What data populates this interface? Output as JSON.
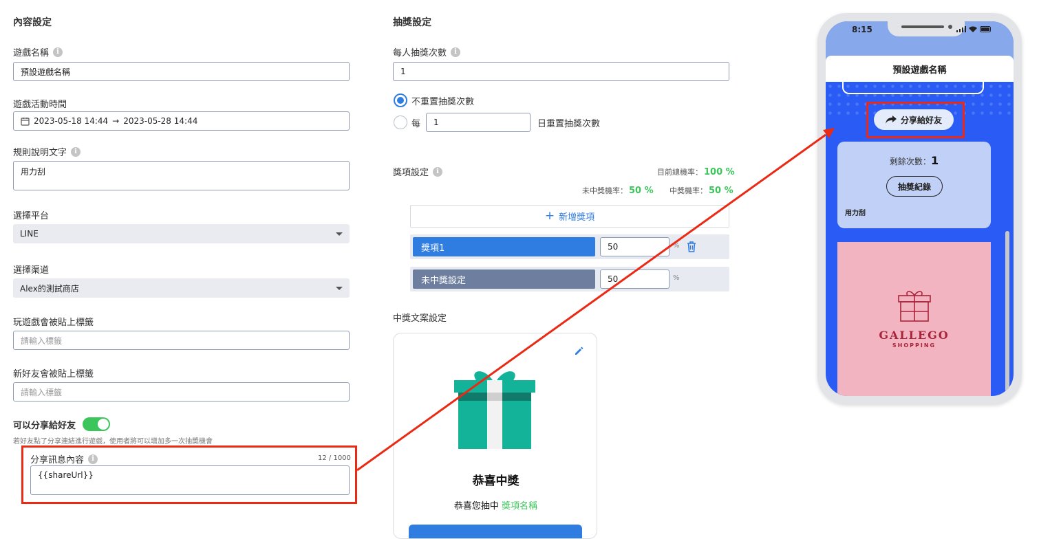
{
  "content": {
    "title": "內容設定",
    "game_name_label": "遊戲名稱",
    "game_name_value": "預設遊戲名稱",
    "time_label": "遊戲活動時間",
    "time_start": "2023-05-18 14:44",
    "time_arrow": "→",
    "time_end": "2023-05-28 14:44",
    "rules_label": "規則說明文字",
    "rules_value": "用力刮",
    "platform_label": "選擇平台",
    "platform_value": "LINE",
    "channel_label": "選擇渠道",
    "channel_value": "Alex的測試商店",
    "play_tag_label": "玩遊戲會被貼上標籤",
    "play_tag_placeholder": "請輸入標籤",
    "friend_tag_label": "新好友會被貼上標籤",
    "friend_tag_placeholder": "請輸入標籤",
    "share_label": "可以分享給好友",
    "share_toggle_on": true,
    "share_hint": "若好友點了分享連結進行遊戲，使用者將可以增加多一次抽獎機會",
    "share_msg_label": "分享訊息內容",
    "share_msg_count": "12 / 1000",
    "share_msg_value": "{{shareUrl}}"
  },
  "lottery": {
    "title": "抽獎設定",
    "per_person_label": "每人抽獎次數",
    "per_person_value": "1",
    "no_reset_label": "不重置抽獎次數",
    "every_label": "每",
    "every_value": "1",
    "daily_reset_label": "日重置抽獎次數",
    "prize_label": "獎項設定",
    "total_rate_label": "目前總機率：",
    "total_rate_value": "100 %",
    "miss_rate_label": "未中獎機率：",
    "miss_rate_value": "50 %",
    "win_rate_label": "中獎機率：",
    "win_rate_value": "50 %",
    "add_prize": "新增獎項",
    "prizes": [
      {
        "name": "獎項1",
        "value": "50",
        "unit": "%"
      },
      {
        "name": "未中獎設定",
        "value": "50",
        "unit": "%"
      }
    ],
    "win_text_label": "中獎文案設定",
    "win_title": "恭喜中獎",
    "win_subtitle_prefix": "恭喜您抽中",
    "win_subtitle_prize": "獎項名稱"
  },
  "phone": {
    "time": "8:15",
    "header_title": "預設遊戲名稱",
    "share_button": "分享給好友",
    "remaining_label": "剩餘次數：",
    "remaining_value": "1",
    "record_button": "抽獎紀錄",
    "rules_text": "用力刮",
    "brand_name": "GALLEGO",
    "brand_sub": "SHOPPING"
  },
  "colors": {
    "accent_blue": "#2f7de1",
    "green": "#3bc55a",
    "red_highlight": "#ea2a14",
    "phone_blue": "#2a5cf5",
    "brand_pink": "#f2b4c0",
    "brand_red": "#a8243a",
    "gift_teal": "#13b39a"
  }
}
